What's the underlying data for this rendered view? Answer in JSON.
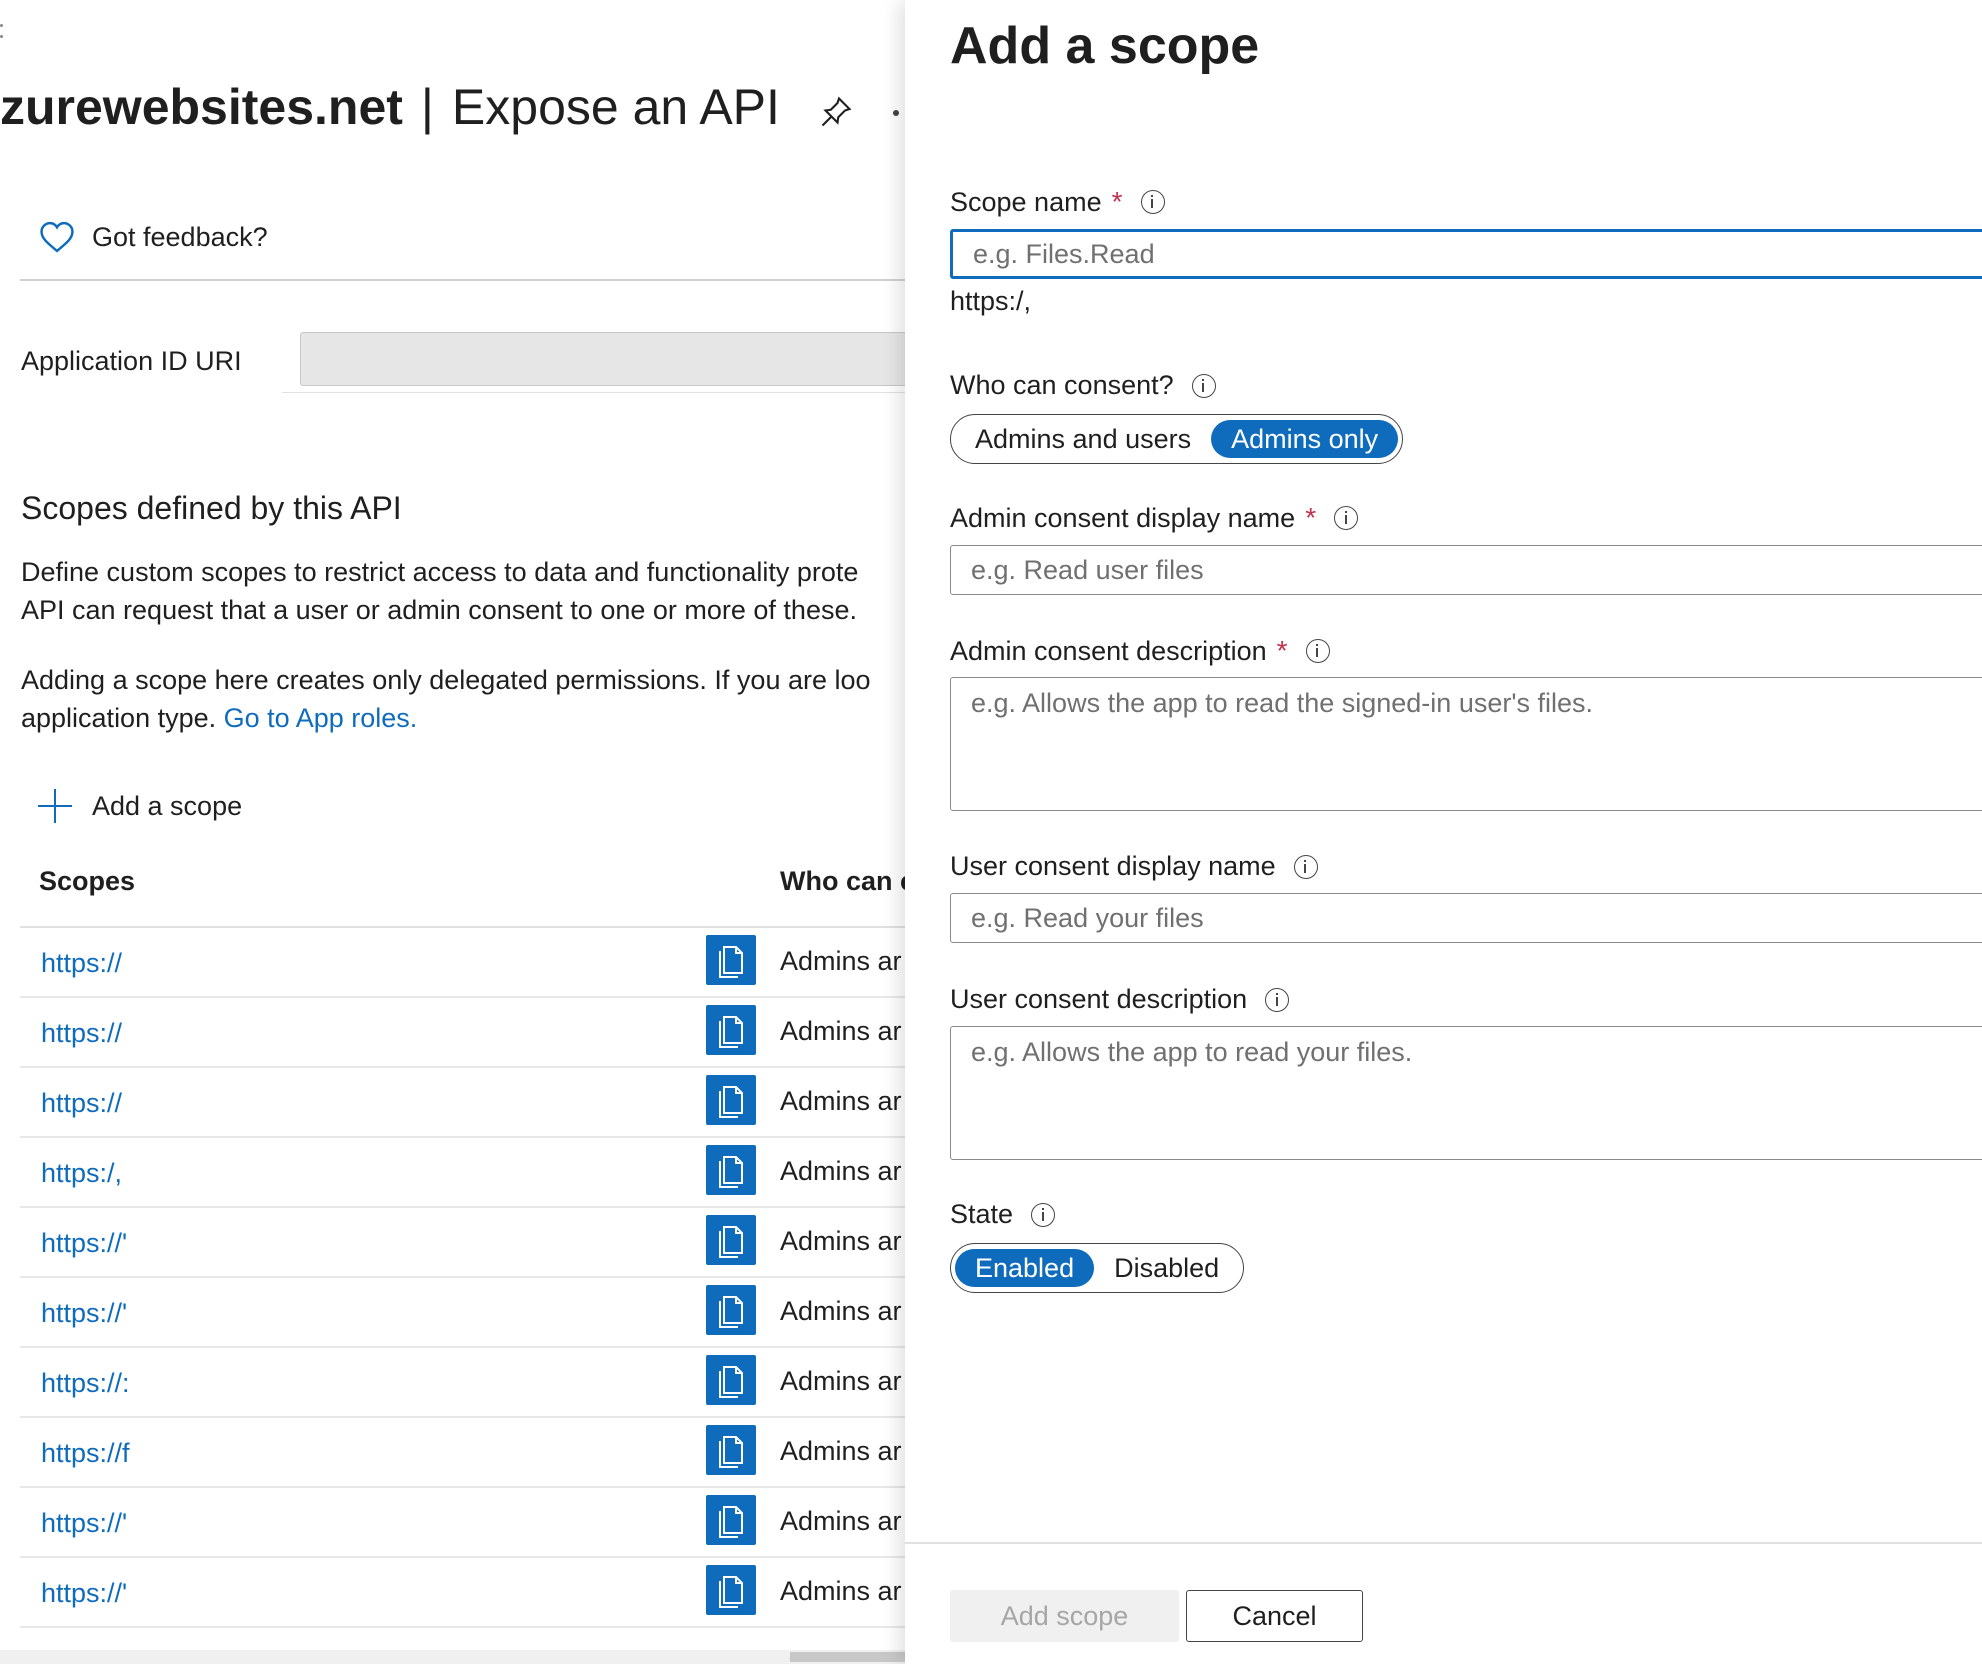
{
  "background": {
    "title_name": "zurewebsites.net",
    "title_separator": "|",
    "title_page": "Expose an API",
    "feedback_label": "Got feedback?",
    "app_id_label": "Application ID URI",
    "app_id_value": "",
    "scopes_heading": "Scopes defined by this API",
    "description_1_line1": "Define custom scopes to restrict access to data and functionality prote",
    "description_1_line2": "API can request that a user or admin consent to one or more of these.",
    "description_2_line1": "Adding a scope here creates only delegated permissions. If you are loo",
    "description_2_line2_prefix": "application type.",
    "app_roles_link": "Go to App roles.",
    "add_scope_command": "Add a scope",
    "table": {
      "columns": [
        "Scopes",
        "Who can c"
      ],
      "rows": [
        {
          "uri": "https://",
          "who": "Admins ar"
        },
        {
          "uri": "https://",
          "who": "Admins ar"
        },
        {
          "uri": "https://",
          "who": "Admins ar"
        },
        {
          "uri": "https:/,",
          "who": "Admins ar"
        },
        {
          "uri": "https://'",
          "who": "Admins ar"
        },
        {
          "uri": "https://'",
          "who": "Admins ar"
        },
        {
          "uri": "https://:",
          "who": "Admins ar"
        },
        {
          "uri": "https://f",
          "who": "Admins ar"
        },
        {
          "uri": "https://'",
          "who": "Admins ar"
        },
        {
          "uri": "https://'",
          "who": "Admins ar"
        }
      ]
    }
  },
  "panel": {
    "title": "Add a scope",
    "scope_name": {
      "label": "Scope name",
      "required": "*",
      "placeholder": "e.g. Files.Read",
      "value": ""
    },
    "uri_preview": "https:/,",
    "who_can_consent": {
      "label": "Who can consent?",
      "options": [
        "Admins and users",
        "Admins only"
      ],
      "selected": "Admins only"
    },
    "admin_display_name": {
      "label": "Admin consent display name",
      "required": "*",
      "placeholder": "e.g. Read user files"
    },
    "admin_description": {
      "label": "Admin consent description",
      "required": "*",
      "placeholder": "e.g. Allows the app to read the signed-in user's files."
    },
    "user_display_name": {
      "label": "User consent display name",
      "placeholder": "e.g. Read your files"
    },
    "user_description": {
      "label": "User consent description",
      "placeholder": "e.g. Allows the app to read your files."
    },
    "state": {
      "label": "State",
      "options": [
        "Enabled",
        "Disabled"
      ],
      "selected": "Enabled"
    },
    "add_scope_button": "Add scope",
    "cancel_button": "Cancel"
  },
  "colors": {
    "accent": "#0f6cbd",
    "required": "#c4314b",
    "disabled_text": "#a6a6a6"
  },
  "icons": [
    "pin-icon",
    "heart-icon",
    "plus-icon",
    "copy-icon",
    "info-icon"
  ]
}
